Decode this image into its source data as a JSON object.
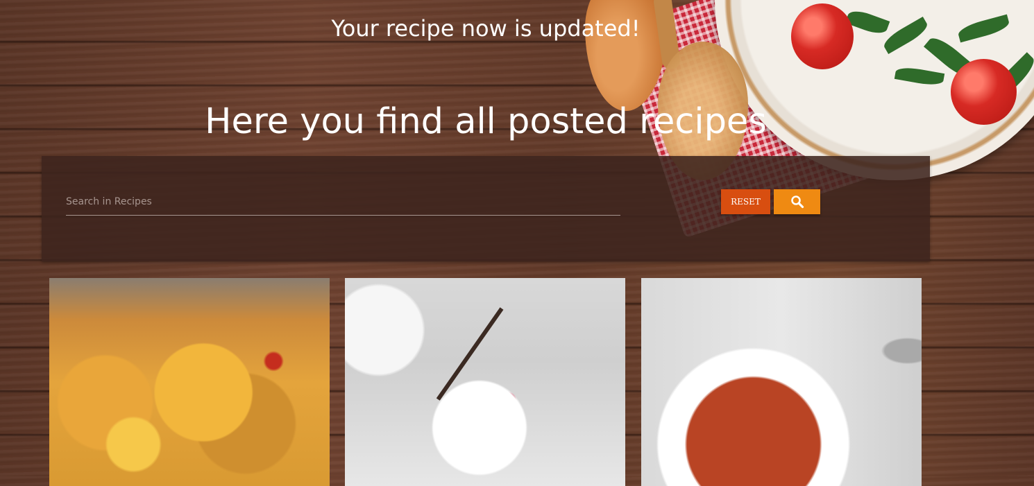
{
  "notice": "Your recipe now is updated!",
  "heading": "Here you find all posted recipes",
  "search": {
    "placeholder": "Search in Recipes",
    "reset_label": "RESET",
    "search_icon": "search-icon"
  },
  "colors": {
    "reset_button": "#d84e10",
    "search_button": "#ef8a12",
    "panel": "#3e241e"
  },
  "recipes": [
    {
      "image": "vegetable-casserole-photo"
    },
    {
      "image": "raspberry-cream-dessert-photo"
    },
    {
      "image": "minestrone-soup-photo"
    }
  ]
}
